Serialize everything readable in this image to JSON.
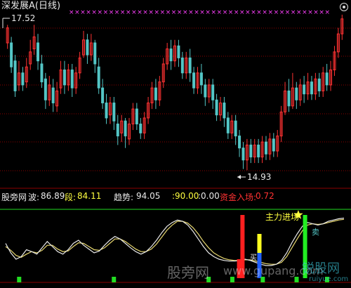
{
  "title": "深发展A(日线)",
  "price_high_label": "17.52",
  "price_low_label": "14.93",
  "indicator": {
    "name": "股旁网",
    "wave_label": "波:",
    "wave_value": "86.89",
    "segment_label": "段:",
    "segment_value": "84.11",
    "trend_label": "趋势:",
    "trend_value": "94.05",
    "v1": ":90.00",
    "v2": ":0.00",
    "fund_label": "资金入场:",
    "fund_value": "0.72"
  },
  "signal_text": "主力进场",
  "sell_marker": "卖",
  "buy_marker": "买",
  "watermark_1": "股旁网",
  "watermark_2": "www.gupang.com",
  "watermark_3": "锐股网",
  "watermark_4": "ruiyue.com",
  "colors": {
    "up": "#ff3232",
    "down": "#54c6c6",
    "magenta": "#ff40ff",
    "yellow": "#ffff40",
    "green": "#22dd22",
    "grid": "#8b0000",
    "white_line": "#e8e8e8",
    "yellow_line": "#e8d870"
  },
  "chart_data": {
    "type": "candlestick",
    "price_axis": {
      "ylim": [
        14.7,
        17.6
      ]
    },
    "high": 17.52,
    "low": 14.93,
    "candles": [
      [
        17.05,
        17.3,
        16.95,
        17.35
      ],
      [
        17.05,
        16.65,
        16.55,
        17.15
      ],
      [
        16.75,
        16.25,
        16.15,
        16.85
      ],
      [
        16.35,
        16.55,
        16.25,
        16.75
      ],
      [
        16.55,
        16.35,
        16.25,
        16.65
      ],
      [
        16.4,
        16.65,
        16.3,
        16.8
      ],
      [
        16.7,
        16.9,
        16.6,
        17.1
      ],
      [
        16.95,
        17.15,
        16.85,
        17.35
      ],
      [
        17.05,
        16.75,
        16.6,
        17.2
      ],
      [
        16.7,
        16.4,
        16.3,
        16.85
      ],
      [
        16.45,
        16.1,
        15.95,
        16.55
      ],
      [
        16.1,
        16.35,
        16.0,
        16.5
      ],
      [
        16.3,
        16.05,
        15.9,
        16.45
      ],
      [
        16.0,
        16.25,
        15.9,
        16.4
      ],
      [
        16.3,
        16.6,
        16.2,
        16.75
      ],
      [
        16.6,
        16.35,
        16.2,
        16.75
      ],
      [
        16.35,
        16.6,
        16.25,
        16.7
      ],
      [
        16.6,
        16.3,
        16.15,
        16.7
      ],
      [
        16.3,
        16.55,
        16.2,
        16.65
      ],
      [
        16.55,
        16.8,
        16.45,
        16.9
      ],
      [
        16.85,
        17.1,
        16.8,
        17.25
      ],
      [
        17.1,
        16.85,
        16.7,
        17.2
      ],
      [
        16.85,
        17.05,
        16.75,
        17.2
      ],
      [
        17.05,
        16.7,
        16.55,
        17.1
      ],
      [
        16.65,
        16.3,
        16.2,
        16.8
      ],
      [
        16.3,
        16.05,
        15.95,
        16.45
      ],
      [
        16.05,
        15.8,
        15.7,
        16.2
      ],
      [
        15.85,
        16.05,
        15.7,
        16.15
      ],
      [
        16.05,
        15.75,
        15.6,
        16.15
      ],
      [
        15.7,
        15.5,
        15.35,
        15.85
      ],
      [
        15.55,
        15.75,
        15.4,
        15.85
      ],
      [
        15.75,
        15.5,
        15.3,
        15.8
      ],
      [
        15.45,
        15.7,
        15.35,
        15.8
      ],
      [
        15.7,
        15.95,
        15.6,
        16.05
      ],
      [
        15.95,
        15.7,
        15.6,
        16.05
      ],
      [
        15.7,
        15.55,
        15.45,
        15.8
      ],
      [
        15.55,
        15.8,
        15.45,
        15.9
      ],
      [
        15.8,
        16.05,
        15.7,
        16.15
      ],
      [
        16.05,
        16.3,
        15.95,
        16.4
      ],
      [
        16.3,
        16.1,
        15.95,
        16.45
      ],
      [
        16.1,
        16.4,
        16.0,
        16.5
      ],
      [
        16.4,
        16.7,
        16.3,
        16.8
      ],
      [
        16.7,
        16.95,
        16.6,
        17.05
      ],
      [
        16.95,
        16.75,
        16.6,
        17.1
      ],
      [
        16.75,
        17.0,
        16.65,
        17.1
      ],
      [
        17.0,
        16.8,
        16.65,
        17.1
      ],
      [
        16.8,
        16.55,
        16.45,
        16.9
      ],
      [
        16.55,
        16.8,
        16.45,
        16.9
      ],
      [
        16.8,
        16.55,
        16.4,
        16.95
      ],
      [
        16.55,
        16.3,
        16.2,
        16.65
      ],
      [
        16.3,
        16.55,
        16.2,
        16.65
      ],
      [
        16.55,
        16.35,
        16.2,
        16.7
      ],
      [
        16.35,
        16.15,
        16.0,
        16.45
      ],
      [
        16.15,
        16.35,
        16.05,
        16.45
      ],
      [
        16.35,
        16.1,
        15.95,
        16.45
      ],
      [
        16.1,
        15.85,
        15.75,
        16.2
      ],
      [
        15.85,
        16.05,
        15.75,
        16.15
      ],
      [
        16.05,
        15.8,
        15.65,
        16.15
      ],
      [
        15.8,
        15.55,
        15.45,
        15.9
      ],
      [
        15.55,
        15.75,
        15.45,
        15.85
      ],
      [
        15.75,
        15.5,
        15.35,
        15.85
      ],
      [
        15.5,
        15.3,
        15.15,
        15.6
      ],
      [
        15.3,
        15.1,
        14.95,
        15.4
      ],
      [
        15.1,
        15.35,
        14.93,
        15.45
      ],
      [
        15.35,
        15.15,
        15.05,
        15.45
      ],
      [
        15.15,
        15.35,
        15.05,
        15.45
      ],
      [
        15.35,
        15.15,
        15.05,
        15.45
      ],
      [
        15.15,
        15.4,
        15.05,
        15.5
      ],
      [
        15.4,
        15.2,
        15.1,
        15.5
      ],
      [
        15.2,
        15.45,
        15.1,
        15.55
      ],
      [
        15.45,
        15.25,
        15.15,
        15.55
      ],
      [
        15.25,
        15.5,
        15.15,
        15.6
      ],
      [
        15.5,
        15.9,
        15.4,
        16.0
      ],
      [
        15.9,
        16.25,
        15.85,
        16.4
      ],
      [
        16.25,
        16.0,
        15.9,
        16.45
      ],
      [
        16.0,
        16.3,
        15.95,
        16.55
      ],
      [
        16.3,
        16.1,
        15.95,
        16.4
      ],
      [
        16.1,
        16.35,
        16.0,
        16.45
      ],
      [
        16.35,
        16.2,
        16.05,
        16.5
      ],
      [
        16.2,
        16.4,
        16.1,
        16.55
      ],
      [
        16.4,
        16.2,
        16.1,
        16.5
      ],
      [
        16.2,
        16.45,
        16.1,
        16.55
      ],
      [
        16.45,
        16.25,
        16.15,
        16.55
      ],
      [
        16.25,
        16.55,
        16.15,
        16.65
      ],
      [
        16.55,
        16.35,
        16.25,
        16.7
      ],
      [
        16.35,
        16.6,
        16.25,
        16.75
      ],
      [
        16.6,
        16.9,
        16.5,
        17.0
      ],
      [
        16.9,
        17.2,
        16.8,
        17.3
      ],
      [
        17.2,
        17.45,
        17.1,
        17.52
      ]
    ],
    "oscillator": {
      "ylim": [
        0,
        100
      ],
      "white": [
        55,
        40,
        30,
        34,
        45,
        42,
        38,
        48,
        58,
        50,
        42,
        38,
        45,
        55,
        60,
        52,
        46,
        40,
        43,
        52,
        60,
        66,
        62,
        55,
        48,
        42,
        38,
        42,
        50,
        60,
        72,
        82,
        88,
        92,
        90,
        84,
        74,
        62,
        50,
        40,
        34,
        30,
        28,
        27,
        27,
        28,
        30,
        28,
        25,
        22,
        20,
        20,
        22,
        28,
        40,
        56,
        70,
        82,
        88,
        86,
        84,
        86,
        90,
        92,
        94,
        95
      ],
      "yellow": [
        50,
        44,
        36,
        33,
        38,
        42,
        40,
        44,
        52,
        52,
        46,
        42,
        43,
        50,
        56,
        55,
        50,
        45,
        44,
        48,
        55,
        62,
        62,
        58,
        52,
        46,
        42,
        42,
        46,
        54,
        65,
        76,
        84,
        90,
        90,
        87,
        80,
        70,
        58,
        48,
        40,
        35,
        31,
        29,
        28,
        28,
        29,
        29,
        27,
        25,
        23,
        22,
        22,
        25,
        34,
        48,
        62,
        75,
        84,
        86,
        85,
        86,
        88,
        90,
        92,
        93
      ],
      "bars": [
        {
          "pos": 0.7,
          "color": "red",
          "from": 0,
          "to": 100
        },
        {
          "pos": 0.69,
          "color": "red",
          "from": 0,
          "to": 30
        },
        {
          "pos": 0.75,
          "color": "yellow",
          "from": 40,
          "to": 70
        },
        {
          "pos": 0.75,
          "color": "blue",
          "from": 0,
          "to": 40
        },
        {
          "pos": 0.885,
          "color": "green",
          "from": 0,
          "to": 100
        }
      ],
      "green_ticks": [
        0.04,
        0.32,
        0.6,
        0.67,
        0.76,
        0.86,
        0.95
      ]
    }
  }
}
